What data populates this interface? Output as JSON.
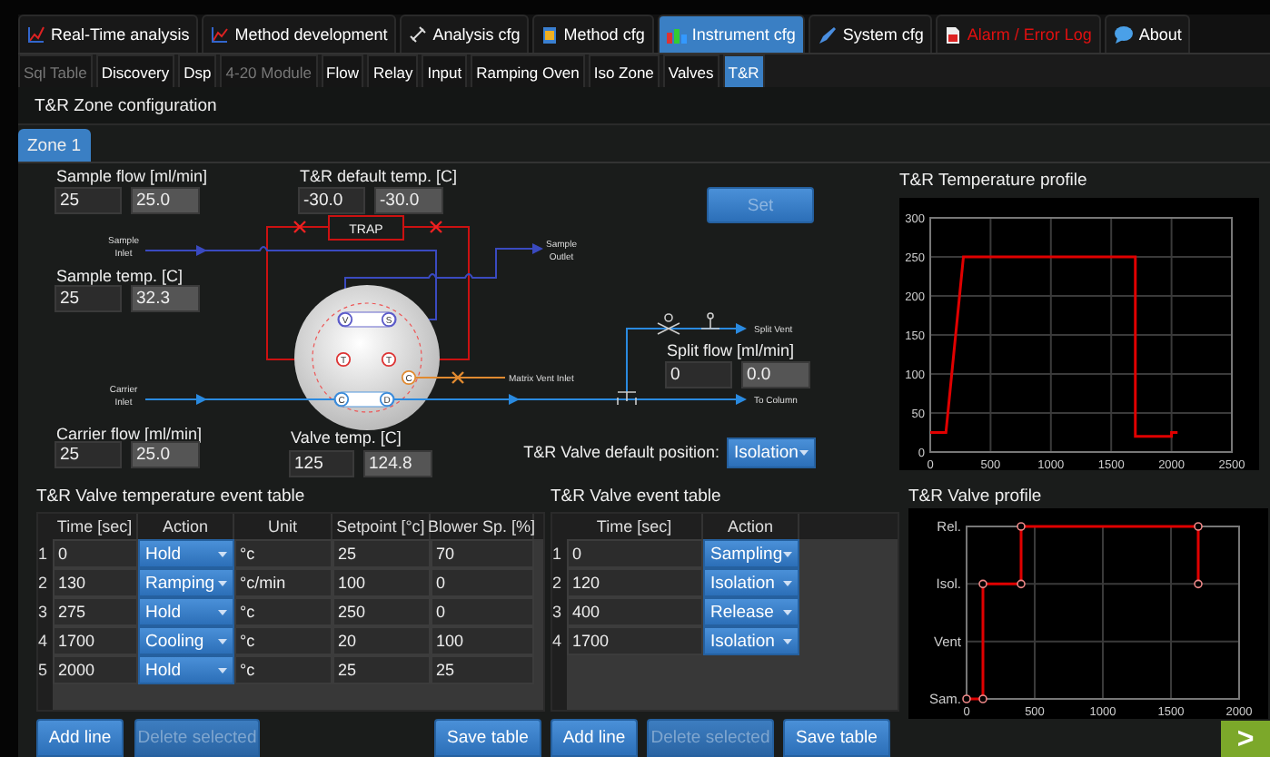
{
  "main_tabs": [
    {
      "label": "Real-Time analysis",
      "selected": false,
      "kind": "normal"
    },
    {
      "label": "Method development",
      "selected": false,
      "kind": "normal"
    },
    {
      "label": "Analysis cfg",
      "selected": false,
      "kind": "normal"
    },
    {
      "label": "Method cfg",
      "selected": false,
      "kind": "normal"
    },
    {
      "label": "Instrument cfg",
      "selected": true,
      "kind": "normal"
    },
    {
      "label": "System cfg",
      "selected": false,
      "kind": "normal"
    },
    {
      "label": "Alarm / Error Log",
      "selected": false,
      "kind": "alert"
    },
    {
      "label": "About",
      "selected": false,
      "kind": "normal"
    }
  ],
  "sub_tabs": [
    {
      "label": "Sql Table",
      "selected": false,
      "disabled": true
    },
    {
      "label": "Discovery",
      "selected": false,
      "disabled": false
    },
    {
      "label": "Dsp",
      "selected": false,
      "disabled": false
    },
    {
      "label": "4-20 Module",
      "selected": false,
      "disabled": true
    },
    {
      "label": "Flow",
      "selected": false,
      "disabled": false
    },
    {
      "label": "Relay",
      "selected": false,
      "disabled": false
    },
    {
      "label": "Input",
      "selected": false,
      "disabled": false
    },
    {
      "label": "Ramping Oven",
      "selected": false,
      "disabled": false
    },
    {
      "label": "Iso Zone",
      "selected": false,
      "disabled": false
    },
    {
      "label": "Valves",
      "selected": false,
      "disabled": false
    },
    {
      "label": "T&R",
      "selected": true,
      "disabled": false
    }
  ],
  "section_title": "T&R Zone configuration",
  "zone_tabs": [
    {
      "label": "Zone 1",
      "selected": true
    }
  ],
  "config": {
    "sample_flow": {
      "label": "Sample flow [ml/min]",
      "setpoint": "25",
      "reading": "25.0"
    },
    "default_temp": {
      "label": "T&R default temp. [C]",
      "setpoint": "-30.0",
      "reading": "-30.0"
    },
    "sample_temp": {
      "label": "Sample temp. [C]",
      "setpoint": "25",
      "reading": "32.3"
    },
    "split_flow": {
      "label": "Split flow [ml/min]",
      "setpoint": "0",
      "reading": "0.0"
    },
    "carrier_flow": {
      "label": "Carrier flow [ml/min]",
      "setpoint": "25",
      "reading": "25.0"
    },
    "valve_temp": {
      "label": "Valve temp. [C]",
      "setpoint": "125",
      "reading": "124.8"
    },
    "set_button": {
      "label": "Set",
      "disabled": true
    },
    "default_position": {
      "label": "T&R Valve default position:",
      "value": "Isolation"
    }
  },
  "diagram": {
    "trap": "TRAP",
    "sample_inlet": [
      "Sample",
      "Inlet"
    ],
    "sample_outlet": [
      "Sample",
      "Outlet"
    ],
    "carrier_inlet": [
      "Carrier",
      "Inlet"
    ],
    "matrix_vent_inlet": "Matrix Vent Inlet",
    "split_vent": "Split Vent",
    "to_column": "To Column",
    "ports": [
      {
        "letter": "V",
        "kind": "sample"
      },
      {
        "letter": "S",
        "kind": "sample"
      },
      {
        "letter": "T",
        "kind": "trap"
      },
      {
        "letter": "T",
        "kind": "trap"
      },
      {
        "letter": "C",
        "kind": "matrix"
      },
      {
        "letter": "C",
        "kind": "carrier"
      },
      {
        "letter": "D",
        "kind": "carrier"
      }
    ]
  },
  "temp_profile": {
    "title": "T&R Temperature profile",
    "chart_data": {
      "type": "line",
      "grid": true,
      "x": [
        0,
        130,
        275,
        1700,
        1700,
        2000,
        2000,
        2050
      ],
      "series": [
        {
          "color": "#e00000",
          "values": [
            25,
            25,
            250,
            250,
            20,
            20,
            25,
            25
          ]
        }
      ],
      "xlim": [
        0,
        2500
      ],
      "ylim": [
        0,
        300
      ],
      "xticks": [
        0,
        500,
        1000,
        1500,
        2000,
        2500
      ],
      "yticks": [
        0,
        50,
        100,
        150,
        200,
        250,
        300
      ]
    }
  },
  "temp_table": {
    "title": "T&R Valve temperature event table",
    "columns": [
      "Time [sec]",
      "Action",
      "Unit",
      "Setpoint [°c]",
      "Blower Sp. [%]"
    ],
    "rows": [
      {
        "index": "1",
        "time": "0",
        "action": "Hold",
        "unit": "°c",
        "setpoint": "25",
        "blower": "70"
      },
      {
        "index": "2",
        "time": "130",
        "action": "Ramping",
        "unit": "°c/min",
        "setpoint": "100",
        "blower": "0"
      },
      {
        "index": "3",
        "time": "275",
        "action": "Hold",
        "unit": "°c",
        "setpoint": "250",
        "blower": "0"
      },
      {
        "index": "4",
        "time": "1700",
        "action": "Cooling",
        "unit": "°c",
        "setpoint": "20",
        "blower": "100"
      },
      {
        "index": "5",
        "time": "2000",
        "action": "Hold",
        "unit": "°c",
        "setpoint": "25",
        "blower": "25"
      }
    ],
    "buttons": [
      {
        "label": "Add line",
        "disabled": false
      },
      {
        "label": "Delete selected",
        "disabled": true
      },
      {
        "label": "Save table",
        "disabled": false
      }
    ]
  },
  "valve_table": {
    "title": "T&R Valve event table",
    "columns": [
      "Time [sec]",
      "Action"
    ],
    "rows": [
      {
        "index": "1",
        "time": "0",
        "action": "Sampling"
      },
      {
        "index": "2",
        "time": "120",
        "action": "Isolation"
      },
      {
        "index": "3",
        "time": "400",
        "action": "Release"
      },
      {
        "index": "4",
        "time": "1700",
        "action": "Isolation"
      }
    ],
    "buttons": [
      {
        "label": "Add line",
        "disabled": false
      },
      {
        "label": "Delete selected",
        "disabled": true
      },
      {
        "label": "Save table",
        "disabled": false
      }
    ]
  },
  "valve_profile": {
    "title": "T&R Valve profile",
    "y_labels": [
      "Rel.",
      "Isol.",
      "Vent",
      "Sam."
    ],
    "x_labels": [
      "0",
      "500",
      "1000",
      "1500",
      "2000"
    ]
  },
  "next_button": {
    "label": ">"
  }
}
